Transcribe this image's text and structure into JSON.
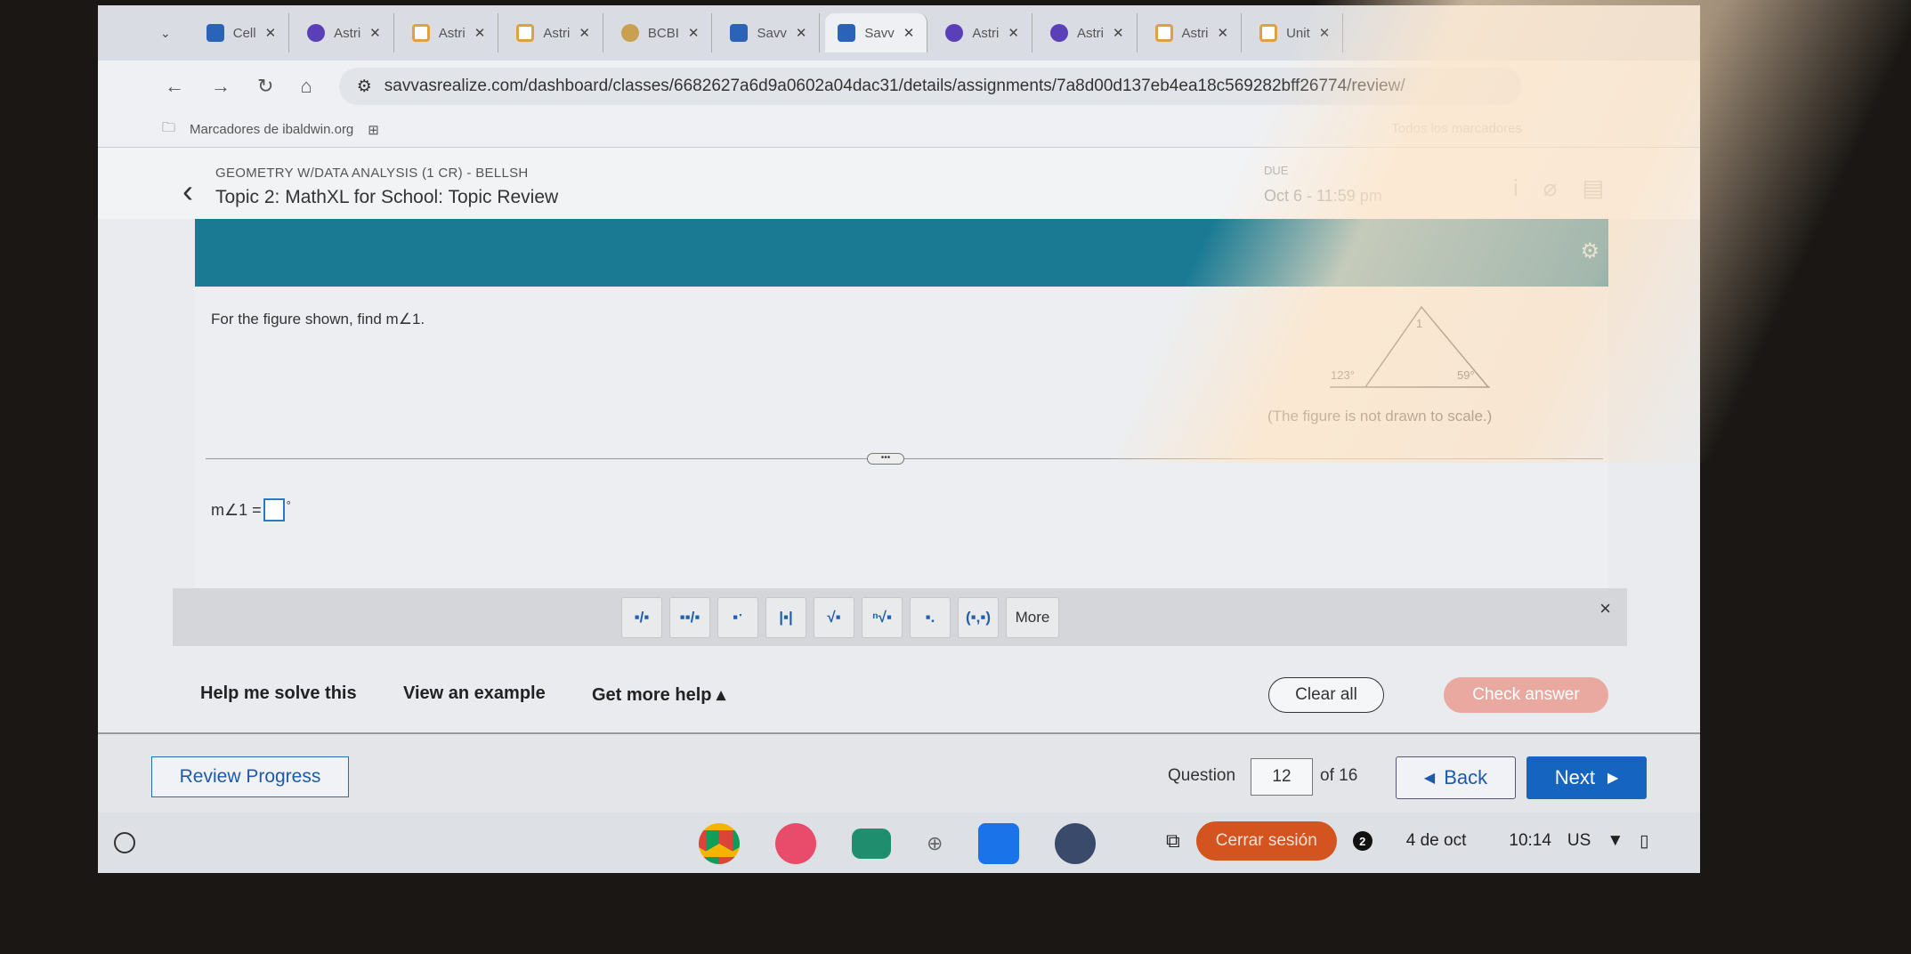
{
  "browser": {
    "tabs": [
      {
        "label": "Cell",
        "icon": "s"
      },
      {
        "label": "Astri",
        "icon": "k"
      },
      {
        "label": "Astri",
        "icon": "o"
      },
      {
        "label": "Astri",
        "icon": "o"
      },
      {
        "label": "BCBI",
        "icon": "b"
      },
      {
        "label": "Savv",
        "icon": "s"
      },
      {
        "label": "Savv",
        "icon": "s",
        "active": true
      },
      {
        "label": "Astri",
        "icon": "k"
      },
      {
        "label": "Astri",
        "icon": "k"
      },
      {
        "label": "Astri",
        "icon": "o"
      },
      {
        "label": "Unit",
        "icon": "o"
      }
    ],
    "url": "savvasrealize.com/dashboard/classes/6682627a6d9a0602a04dac31/details/assignments/7a8d00d137eb4ea18c569282bff26774/review/",
    "bookmarks_label": "Marcadores de ibaldwin.org",
    "all_bookmarks": "Todos los marcadores"
  },
  "header": {
    "course": "GEOMETRY W/DATA ANALYSIS (1 CR) - BELLSH",
    "title": "Topic 2: MathXL for School: Topic Review",
    "due_label": "DUE",
    "due_date": "Oct 6 - 11:59 pm"
  },
  "question": {
    "prompt": "For the figure shown, find m∠1.",
    "figure": {
      "angle_top": "1",
      "angle_exterior": "123°",
      "angle_right": "59°"
    },
    "caption": "(The figure is not drawn to scale.)",
    "answer_prefix": "m∠1 =",
    "answer_suffix": "°",
    "answer_value": ""
  },
  "toolbar": {
    "buttons": [
      {
        "name": "fraction",
        "glyph": "▪/▪"
      },
      {
        "name": "mixed-number",
        "glyph": "▪▪/▪"
      },
      {
        "name": "exponent",
        "glyph": "▪ˑ"
      },
      {
        "name": "absolute-value",
        "glyph": "|▪|"
      },
      {
        "name": "square-root",
        "glyph": "√▪"
      },
      {
        "name": "nth-root",
        "glyph": "ⁿ√▪"
      },
      {
        "name": "subscript",
        "glyph": "▪."
      },
      {
        "name": "ordered-pair",
        "glyph": "(▪,▪)"
      }
    ],
    "more": "More",
    "close": "×"
  },
  "help": {
    "help_me": "Help me solve this",
    "example": "View an example",
    "more_help": "Get more help ▴",
    "clear": "Clear all",
    "check": "Check answer"
  },
  "nav": {
    "review": "Review Progress",
    "question_label": "Question",
    "question_number": "12",
    "of": "of 16",
    "back": "Back",
    "next": "Next"
  },
  "shelf": {
    "logout": "Cerrar sesión",
    "notifications": "2",
    "date": "4 de oct",
    "time": "10:14",
    "locale": "US"
  },
  "colors": {
    "teal": "#1a7a94",
    "primary": "#1564c0",
    "logout": "#d3541e",
    "check": "#e9a9a0"
  }
}
